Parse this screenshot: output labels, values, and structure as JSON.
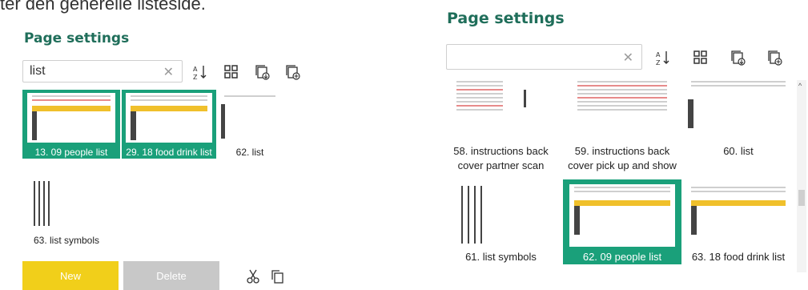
{
  "header_text": "ter den generelle listeside.",
  "left": {
    "title": "Page settings",
    "search_value": "list",
    "thumbs": [
      {
        "label": "13. 09 people list",
        "selected": true
      },
      {
        "label": "29. 18 food drink list",
        "selected": true
      },
      {
        "label": "62. list",
        "selected": false
      },
      {
        "label": "63. list symbols",
        "selected": false
      }
    ],
    "new_label": "New",
    "delete_label": "Delete"
  },
  "right": {
    "title": "Page settings",
    "search_value": "",
    "thumbs": [
      {
        "label": "58. instructions back cover partner scan",
        "selected": false
      },
      {
        "label": "59. instructions back cover pick up and show",
        "selected": false
      },
      {
        "label": "60. list",
        "selected": false
      },
      {
        "label": "61. list symbols",
        "selected": false
      },
      {
        "label": "62. 09 people list",
        "selected": true
      },
      {
        "label": "63. 18 food drink list",
        "selected": false
      }
    ]
  },
  "icons": [
    "sort-az-icon",
    "grid-icon",
    "insert-page-icon",
    "add-page-icon",
    "clear-icon",
    "cut-icon",
    "copy-icon"
  ],
  "colors": {
    "accent": "#1aa07a",
    "title": "#1f6e5a",
    "new_button": "#f1cf1a",
    "delete_button": "#c8c8c8"
  }
}
